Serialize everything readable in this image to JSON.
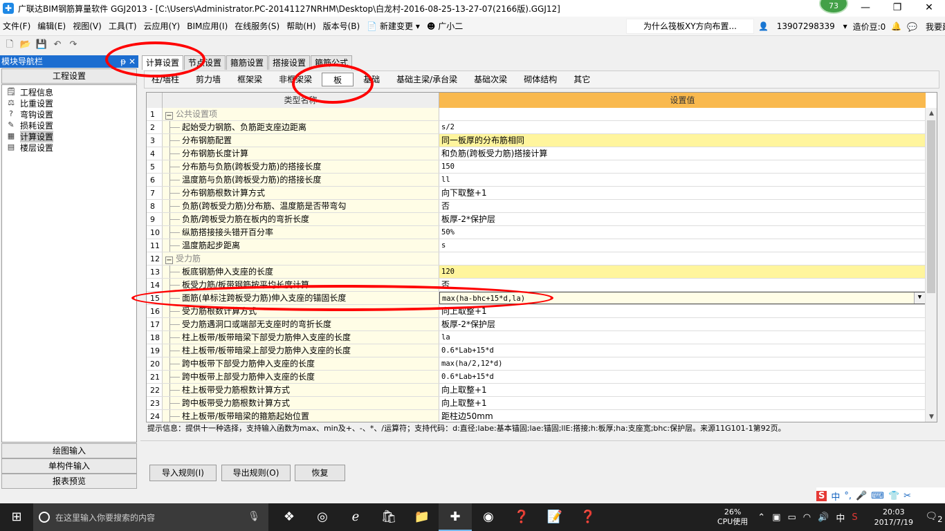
{
  "window": {
    "title": "广联达BIM钢筋算量软件 GGJ2013 - [C:\\Users\\Administrator.PC-20141127NRHM\\Desktop\\白龙村-2016-08-25-13-27-07(2166版).GGJ12]",
    "badge": "73",
    "minimize": "—",
    "maximize": "❐",
    "close": "✕"
  },
  "menu": {
    "items": [
      "文件(F)",
      "编辑(E)",
      "视图(V)",
      "工具(T)",
      "云应用(Y)",
      "BIM应用(I)",
      "在线服务(S)",
      "帮助(H)",
      "版本号(B)",
      "新建变更",
      "广小二"
    ],
    "notice": "为什么筏板XY方向布置...",
    "phone": "13907298339",
    "beans": "造价豆:0",
    "suggest": "我要建议"
  },
  "sidebar": {
    "header": "模块导航栏",
    "pin": "ᵽ ✕",
    "section": "工程设置",
    "tree": [
      "工程信息",
      "比重设置",
      "弯钩设置",
      "损耗设置",
      "计算设置",
      "楼层设置"
    ],
    "selected": "计算设置",
    "bottom": [
      "绘图输入",
      "单构件输入",
      "报表预览"
    ]
  },
  "tabs": {
    "top": [
      "计算设置",
      "节点设置",
      "箍筋设置",
      "搭接设置",
      "箍筋公式"
    ],
    "sub": [
      "柱/墙柱",
      "剪力墙",
      "框架梁",
      "非框架梁",
      "板",
      "基础",
      "基础主梁/承台梁",
      "基础次梁",
      "砌体结构",
      "其它"
    ]
  },
  "grid": {
    "col_name": "类型名称",
    "col_value": "设置值",
    "rows": [
      {
        "n": "1",
        "name": "公共设置项",
        "value": "",
        "group": true
      },
      {
        "n": "2",
        "name": "起始受力钢筋、负筋距支座边距离",
        "value": "s/2"
      },
      {
        "n": "3",
        "name": "分布钢筋配置",
        "value": "同一板厚的分布筋相同",
        "hl": true
      },
      {
        "n": "4",
        "name": "分布钢筋长度计算",
        "value": "和负筋(跨板受力筋)搭接计算"
      },
      {
        "n": "5",
        "name": "分布筋与负筋(跨板受力筋)的搭接长度",
        "value": "150"
      },
      {
        "n": "6",
        "name": "温度筋与负筋(跨板受力筋)的搭接长度",
        "value": "ll"
      },
      {
        "n": "7",
        "name": "分布钢筋根数计算方式",
        "value": "向下取整+1"
      },
      {
        "n": "8",
        "name": "负筋(跨板受力筋)分布筋、温度筋是否带弯勾",
        "value": "否"
      },
      {
        "n": "9",
        "name": "负筋/跨板受力筋在板内的弯折长度",
        "value": "板厚-2*保护层"
      },
      {
        "n": "10",
        "name": "纵筋搭接接头错开百分率",
        "value": "50%"
      },
      {
        "n": "11",
        "name": "温度筋起步距离",
        "value": "s"
      },
      {
        "n": "12",
        "name": "受力筋",
        "value": "",
        "group": true
      },
      {
        "n": "13",
        "name": "板底钢筋伸入支座的长度",
        "value": "120",
        "hl": true
      },
      {
        "n": "14",
        "name": "板受力筋/板带钢筋按平均长度计算",
        "value": "否"
      },
      {
        "n": "15",
        "name": "面筋(单标注跨板受力筋)伸入支座的锚固长度",
        "value": "max(ha-bhc+15*d,la)",
        "edit": true
      },
      {
        "n": "16",
        "name": "受力筋根数计算方式",
        "value": "向上取整+1"
      },
      {
        "n": "17",
        "name": "受力筋遇洞口或端部无支座时的弯折长度",
        "value": "板厚-2*保护层"
      },
      {
        "n": "18",
        "name": "柱上板带/板带暗梁下部受力筋伸入支座的长度",
        "value": "la"
      },
      {
        "n": "19",
        "name": "柱上板带/板带暗梁上部受力筋伸入支座的长度",
        "value": "0.6*Lab+15*d"
      },
      {
        "n": "20",
        "name": "跨中板带下部受力筋伸入支座的长度",
        "value": "max(ha/2,12*d)"
      },
      {
        "n": "21",
        "name": "跨中板带上部受力筋伸入支座的长度",
        "value": "0.6*Lab+15*d"
      },
      {
        "n": "22",
        "name": "柱上板带受力筋根数计算方式",
        "value": "向上取整+1"
      },
      {
        "n": "23",
        "name": "跨中板带受力筋根数计算方式",
        "value": "向上取整+1"
      },
      {
        "n": "24",
        "name": "柱上板带/板带暗梁的箍筋起始位置",
        "value": "距柱边50mm"
      }
    ]
  },
  "hint": "提示信息：提供十一种选择，支持输入函数为max、min及+、-、*、/运算符；支持代码：d:直径;labe:基本锚固;lae:锚固;llE:搭接;h:板厚;ha:支座宽;bhc:保护层。来源11G101-1第92页。",
  "buttons": {
    "import": "导入规则(I)",
    "export": "导出规则(O)",
    "restore": "恢复"
  },
  "ime": [
    "S",
    "中",
    "°,",
    "🎤",
    "⌨",
    "👕",
    "✂"
  ],
  "taskbar": {
    "search_placeholder": "在这里输入你要搜索的内容",
    "cpu_pct": "26%",
    "cpu_label": "CPU使用",
    "ime_lang": "中",
    "time": "20:03",
    "date": "2017/7/19",
    "notif_count": "2"
  }
}
